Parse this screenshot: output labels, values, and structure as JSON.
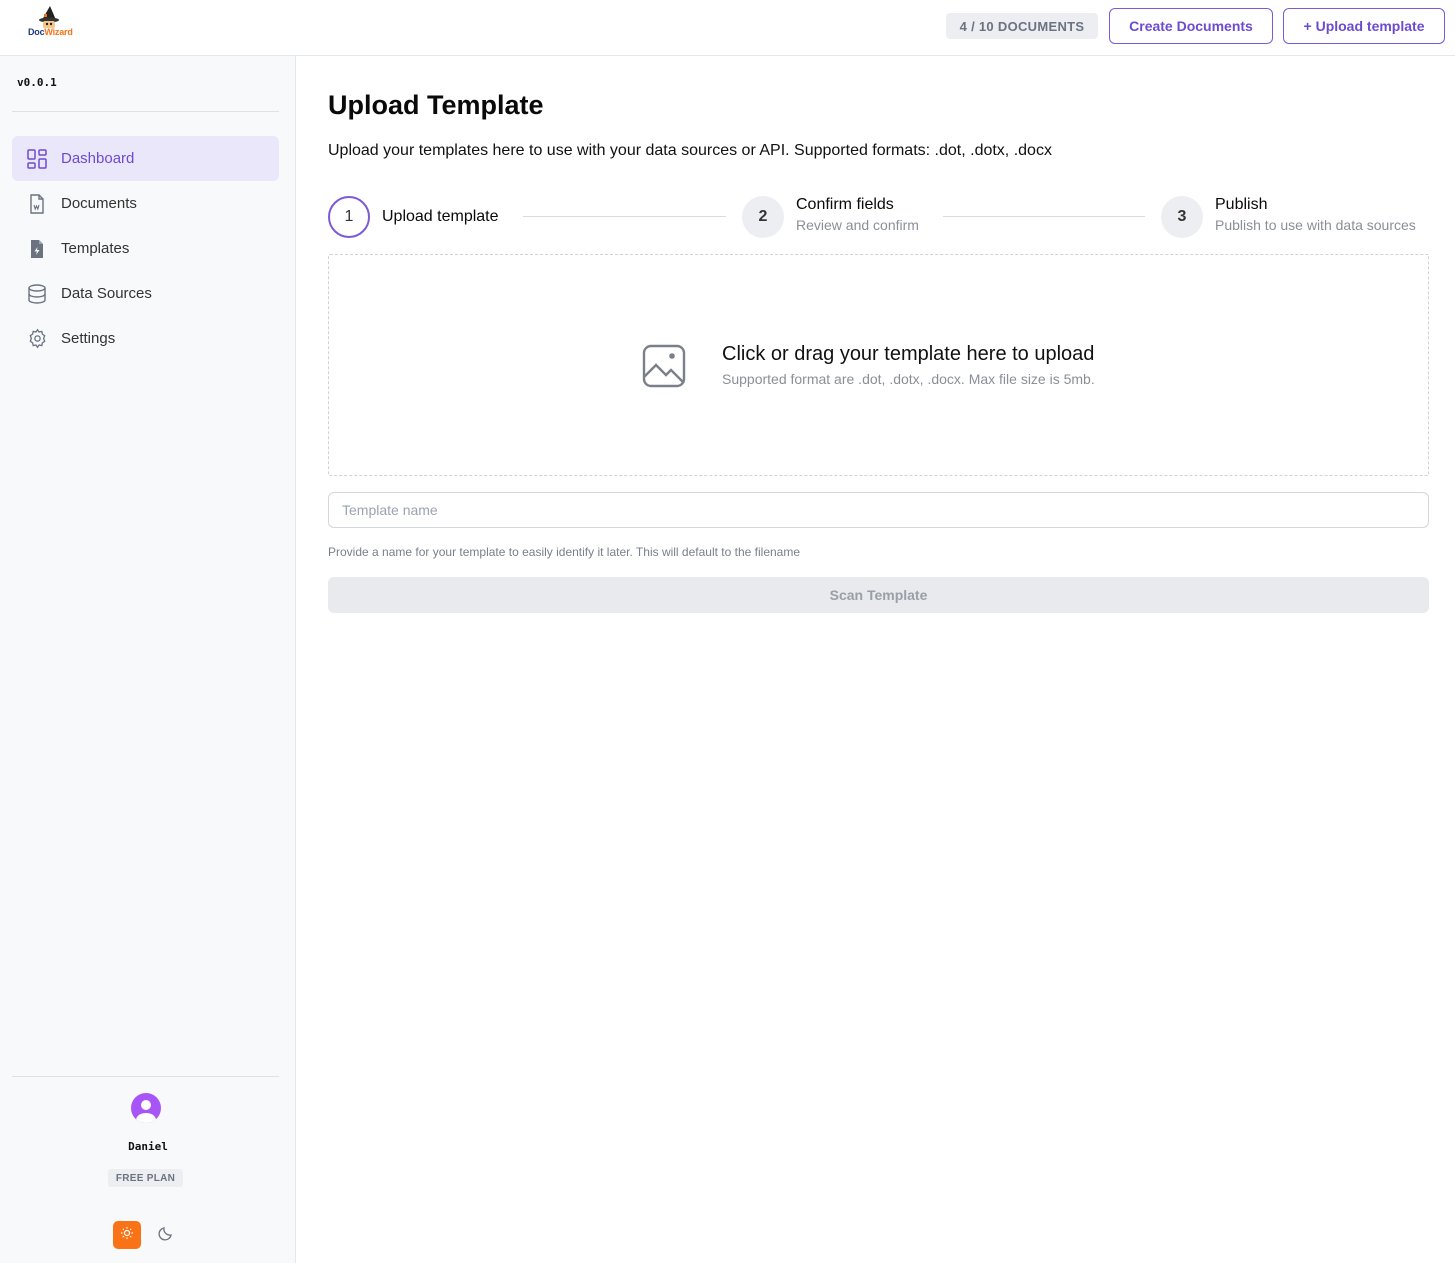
{
  "header": {
    "logo_text_a": "Doc",
    "logo_text_b": "Wizard",
    "doc_count": "4 / 10 DOCUMENTS",
    "create_documents": "Create Documents",
    "upload_template": "+ Upload template"
  },
  "sidebar": {
    "version": "v0.0.1",
    "items": [
      {
        "label": "Dashboard",
        "icon": "dashboard-icon",
        "active": true
      },
      {
        "label": "Documents",
        "icon": "document-icon",
        "active": false
      },
      {
        "label": "Templates",
        "icon": "template-icon",
        "active": false
      },
      {
        "label": "Data Sources",
        "icon": "database-icon",
        "active": false
      },
      {
        "label": "Settings",
        "icon": "gear-icon",
        "active": false
      }
    ],
    "user": {
      "name": "Daniel",
      "plan": "FREE PLAN"
    }
  },
  "main": {
    "title": "Upload Template",
    "description": "Upload your templates here to use with your data sources or API. Supported formats: .dot, .dotx, .docx",
    "steps": [
      {
        "number": "1",
        "title": "Upload template",
        "subtitle": "",
        "active": true
      },
      {
        "number": "2",
        "title": "Confirm fields",
        "subtitle": "Review and confirm",
        "active": false
      },
      {
        "number": "3",
        "title": "Publish",
        "subtitle": "Publish to use with data sources",
        "active": false
      }
    ],
    "dropzone": {
      "title": "Click or drag your template here to upload",
      "subtitle": "Supported format are .dot, .dotx, .docx. Max file size is 5mb."
    },
    "name_input": {
      "placeholder": "Template name",
      "value": ""
    },
    "hint": "Provide a name for your template to easily identify it later. This will default to the filename",
    "scan_button": "Scan Template"
  },
  "colors": {
    "accent": "#6d4bd0",
    "active_bg": "#ebe7fa",
    "theme_light": "#f97316",
    "avatar": "#a855f7"
  }
}
